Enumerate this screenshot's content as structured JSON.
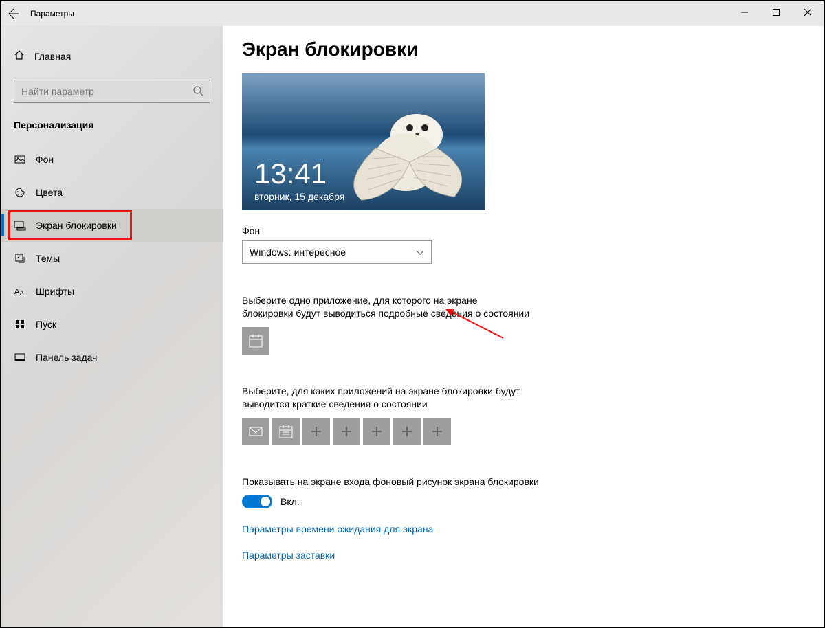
{
  "titlebar": {
    "app_name": "Параметры"
  },
  "sidebar": {
    "home_label": "Главная",
    "search_placeholder": "Найти параметр",
    "section_title": "Персонализация",
    "items": [
      {
        "label": "Фон"
      },
      {
        "label": "Цвета"
      },
      {
        "label": "Экран блокировки"
      },
      {
        "label": "Темы"
      },
      {
        "label": "Шрифты"
      },
      {
        "label": "Пуск"
      },
      {
        "label": "Панель задач"
      }
    ]
  },
  "main": {
    "page_title": "Экран блокировки",
    "preview": {
      "time": "13:41",
      "date": "вторник, 15 декабря"
    },
    "bg_label": "Фон",
    "bg_value": "Windows: интересное",
    "detail_text": "Выберите одно приложение, для которого на экране блокировки будут выводиться подробные сведения о состоянии",
    "quick_text": "Выберите, для каких приложений на экране блокировки будут выводится краткие сведения о состоянии",
    "toggle_label_text": "Показывать на экране входа фоновый рисунок экрана блокировки",
    "toggle_state": "Вкл.",
    "link1": "Параметры времени ожидания для экрана",
    "link2": "Параметры заставки"
  }
}
